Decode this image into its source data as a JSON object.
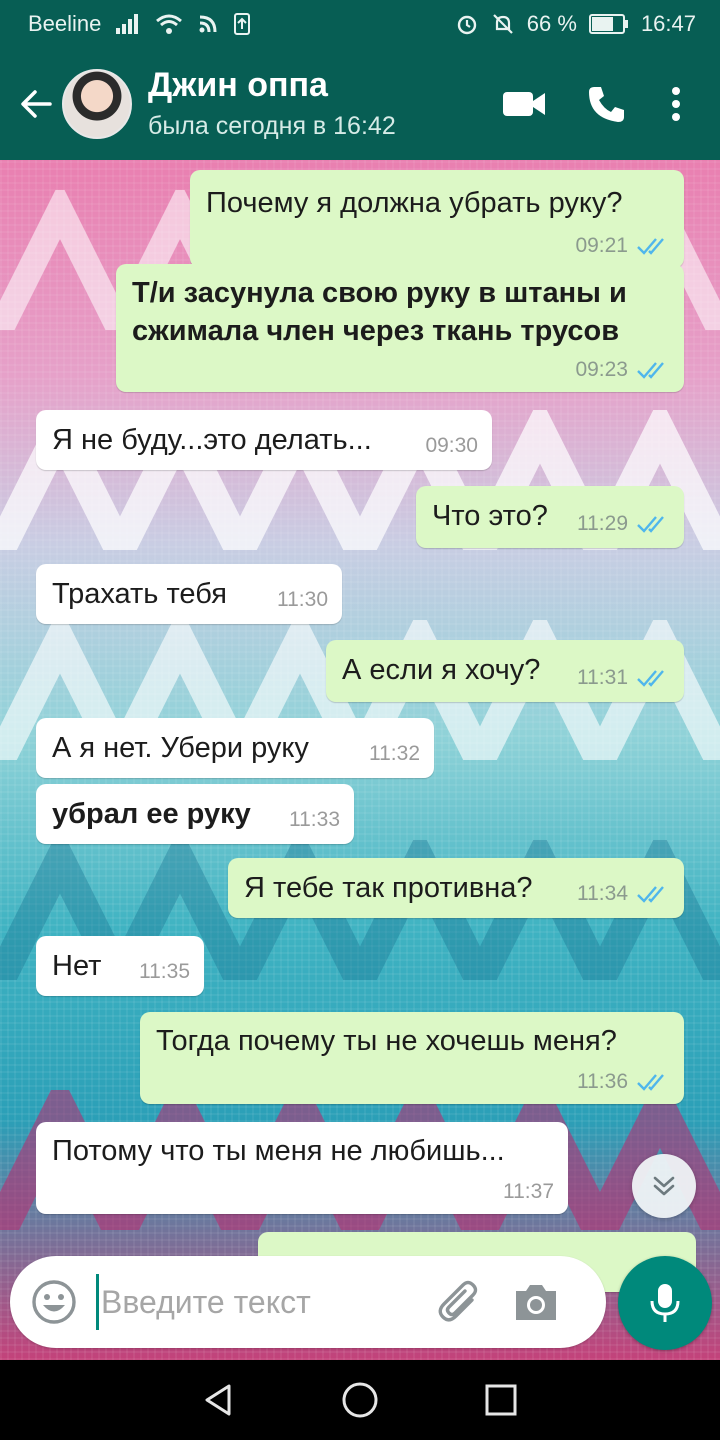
{
  "status_bar": {
    "carrier": "Beeline",
    "battery": "66 %",
    "time": "16:47"
  },
  "header": {
    "contact_name": "Джин оппа",
    "last_seen": "была сегодня в 16:42"
  },
  "messages": [
    {
      "text": "Почему я должна убрать руку?",
      "time": "09:21",
      "direction": "outgoing"
    },
    {
      "text": "Т/и засунула свою руку в штаны и сжимала член через ткань трусов",
      "time": "09:23",
      "direction": "outgoing"
    },
    {
      "text": "Я не буду...это делать...",
      "time": "09:30",
      "direction": "incoming"
    },
    {
      "text": "Что это?",
      "time": "11:29",
      "direction": "outgoing"
    },
    {
      "text": "Трахать тебя",
      "time": "11:30",
      "direction": "incoming"
    },
    {
      "text": "А если я хочу?",
      "time": "11:31",
      "direction": "outgoing"
    },
    {
      "text": "А я нет. Убери руку",
      "time": "11:32",
      "direction": "incoming"
    },
    {
      "text": "убрал ее руку",
      "time": "11:33",
      "direction": "incoming"
    },
    {
      "text": "Я тебе так противна?",
      "time": "11:34",
      "direction": "outgoing"
    },
    {
      "text": "Нет",
      "time": "11:35",
      "direction": "incoming"
    },
    {
      "text": "Тогда почему ты не хочешь меня?",
      "time": "11:36",
      "direction": "outgoing"
    },
    {
      "text": "Потому что ты меня не любишь...",
      "time": "11:37",
      "direction": "incoming"
    }
  ],
  "input": {
    "placeholder": "Введите текст"
  },
  "colors": {
    "header": "#075e54",
    "outgoing_bubble": "#dcf8c6",
    "incoming_bubble": "#ffffff",
    "accent": "#00897b",
    "read_tick": "#4fb6ec"
  },
  "icons": [
    "back-arrow-icon",
    "video-call-icon",
    "phone-icon",
    "more-vert-icon",
    "emoji-icon",
    "attach-icon",
    "camera-icon",
    "mic-icon",
    "chevron-double-down-icon",
    "double-check-icon"
  ]
}
